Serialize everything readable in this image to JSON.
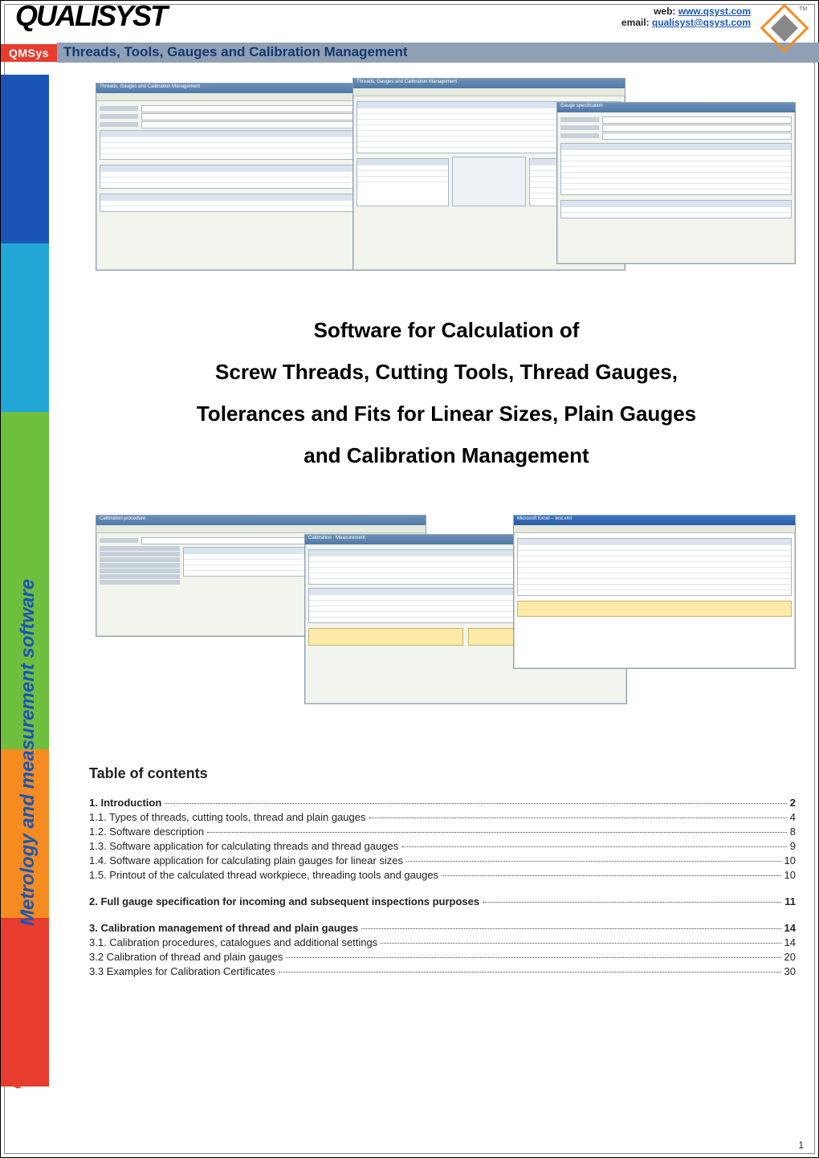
{
  "header": {
    "logo_text": "QUALISYST",
    "qmsys": "QMSys",
    "products_line": "Threads, Tools, Gauges and Calibration Management",
    "web_label": "web:",
    "web_value": "www.qsyst.com",
    "email_label": "email:",
    "email_value": "qualisyst@qsyst.com",
    "tm": "TM"
  },
  "side_rail_text": "Metrology and measurement software",
  "screenshots": {
    "group1": {
      "panel_a": {
        "title": "Threads, Gauges and Calibration Management"
      },
      "panel_b": {
        "title": "Threads, Gauges and Calibration Management"
      },
      "panel_c": {
        "title": "Gauge specification"
      }
    },
    "group2": {
      "panel_d": {
        "title": "Calibration procedure"
      },
      "panel_e": {
        "title": "Calibration · Measurement"
      },
      "panel_f": {
        "title": "Microsoft Excel – test.xml"
      }
    }
  },
  "big_title_lines": [
    "Software for Calculation of",
    "Screw Threads, Cutting Tools, Thread Gauges,",
    "Tolerances and Fits for Linear Sizes, Plain Gauges",
    "and Calibration Management"
  ],
  "toc_heading": "Table of contents",
  "toc": [
    {
      "label": "1. Introduction",
      "page": "2",
      "bold": true
    },
    {
      "label": "1.1. Types of threads, cutting tools, thread and plain gauges",
      "page": "4",
      "bold": false
    },
    {
      "label": "1.2. Software description",
      "page": "8",
      "bold": false
    },
    {
      "label": "1.3. Software application for calculating threads and thread gauges",
      "page": "9",
      "bold": false
    },
    {
      "label": "1.4. Software application for calculating plain gauges for linear sizes",
      "page": "10",
      "bold": false
    },
    {
      "label": "1.5. Printout of the calculated thread workpiece, threading tools and gauges",
      "page": "10",
      "bold": false
    },
    {
      "label": "2. Full gauge specification for incoming and subsequent inspections purposes",
      "page": "11",
      "bold": true
    },
    {
      "label": "3. Calibration management of thread and plain gauges",
      "page": "14",
      "bold": true
    },
    {
      "label": "3.1. Calibration procedures, catalogues and additional settings",
      "page": "14",
      "bold": false
    },
    {
      "label": "3.2 Calibration of thread and plain gauges",
      "page": "20",
      "bold": false
    },
    {
      "label": "3.3 Examples for Calibration Certificates",
      "page": "30",
      "bold": false
    }
  ],
  "footer_page_number": "1"
}
